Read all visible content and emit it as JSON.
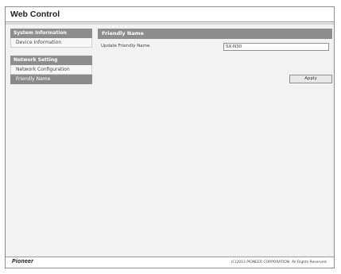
{
  "window": {
    "title": "Web Control"
  },
  "sidebar": {
    "sections": [
      {
        "heading": "System Information",
        "items": [
          {
            "label": "Device Information",
            "active": false
          }
        ]
      },
      {
        "heading": "Network Setting",
        "items": [
          {
            "label": "Network Configuration",
            "active": false
          },
          {
            "label": "Friendly Name",
            "active": true
          }
        ]
      }
    ]
  },
  "main": {
    "heading": "Friendly Name",
    "field_label": "Update Friendly Name",
    "field_value": "SX-N30",
    "apply_label": "Apply"
  },
  "footer": {
    "logo": "Pioneer",
    "copyright": "(C)2013 PIONEER CORPORATION. All Rights Reserved."
  },
  "colors": {
    "section_header": "#8d8d8d",
    "active_item": "#8a8a8a",
    "background": "#f2f2f2"
  }
}
